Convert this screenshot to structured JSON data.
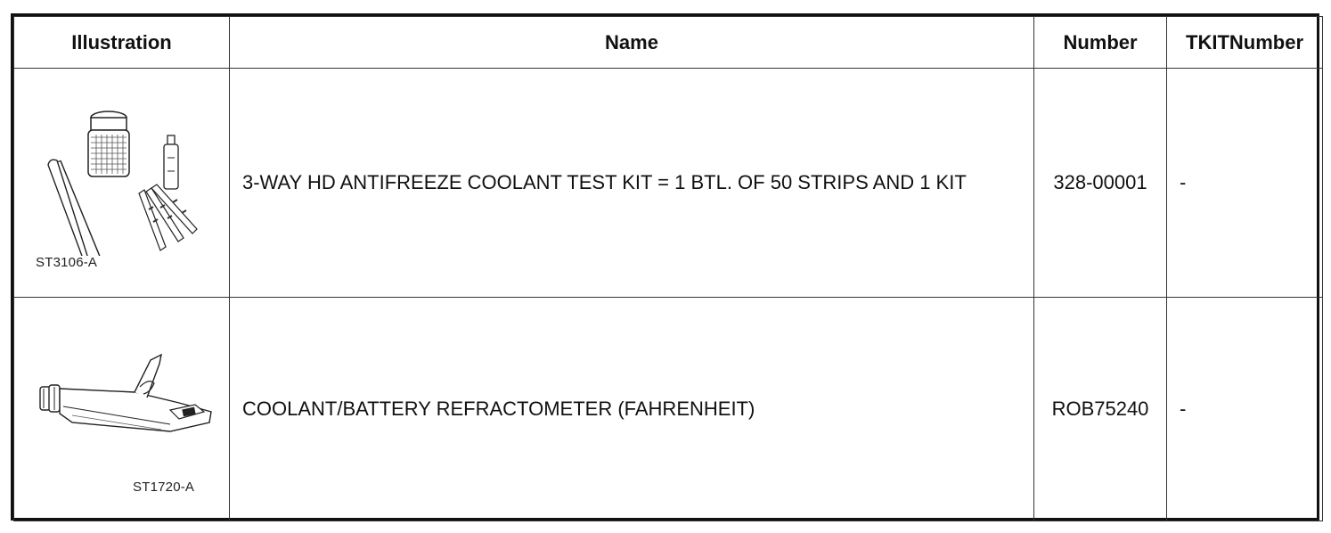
{
  "table": {
    "headers": {
      "illustration": "Illustration",
      "name": "Name",
      "number": "Number",
      "tkit": "TKITNumber"
    },
    "rows": [
      {
        "illustration_code": "ST3106-A",
        "illustration_icon": "coolant-test-kit-icon",
        "name": "3-WAY HD ANTIFREEZE COOLANT TEST KIT = 1 BTL. OF 50 STRIPS AND 1 KIT",
        "number": "328-00001",
        "tkit": "-"
      },
      {
        "illustration_code": "ST1720-A",
        "illustration_icon": "refractometer-icon",
        "name": "COOLANT/BATTERY REFRACTOMETER (FAHRENHEIT)",
        "number": "ROB75240",
        "tkit": "-"
      }
    ]
  }
}
